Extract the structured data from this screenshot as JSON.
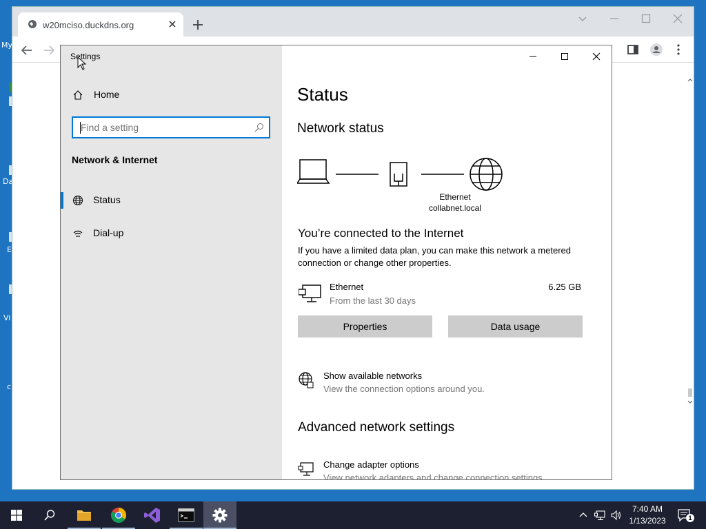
{
  "desktop": {
    "fragments": [
      "My",
      "Da",
      "E",
      "Vi",
      "c"
    ]
  },
  "browser": {
    "tab_title": "w20mciso.duckdns.org"
  },
  "settings": {
    "window_title": "Settings",
    "sidebar": {
      "home_label": "Home",
      "search_placeholder": "Find a setting",
      "section_label": "Network & Internet",
      "items": [
        {
          "label": "Status",
          "icon": "globe-icon",
          "active": true
        },
        {
          "label": "Dial-up",
          "icon": "dialup-icon",
          "active": false
        }
      ]
    },
    "content": {
      "page_title": "Status",
      "network_status_heading": "Network status",
      "diagram": {
        "adapter_label": "Ethernet",
        "network_label": "collabnet.local"
      },
      "connected_title": "You’re connected to the Internet",
      "connected_desc": "If you have a limited data plan, you can make this network a metered connection or change other properties.",
      "adapter": {
        "name": "Ethernet",
        "subtitle": "From the last 30 days",
        "usage": "6.25 GB"
      },
      "buttons": {
        "properties": "Properties",
        "data_usage": "Data usage"
      },
      "show_networks": {
        "title": "Show available networks",
        "subtitle": "View the connection options around you."
      },
      "advanced_heading": "Advanced network settings",
      "change_adapter": {
        "title": "Change adapter options",
        "subtitle": "View network adapters and change connection settings."
      }
    }
  },
  "taskbar": {
    "apps": [
      "start-button",
      "search-button",
      "file-explorer",
      "chrome",
      "visual-studio",
      "terminal",
      "settings"
    ],
    "time": "7:40 AM",
    "date": "1/13/2023",
    "notification_count": "1"
  },
  "colors": {
    "accent": "#0078d7",
    "desktop": "#1f74c2",
    "taskbar": "#1c2030",
    "sidebar": "#e6e6e6",
    "button": "#cccccc"
  }
}
